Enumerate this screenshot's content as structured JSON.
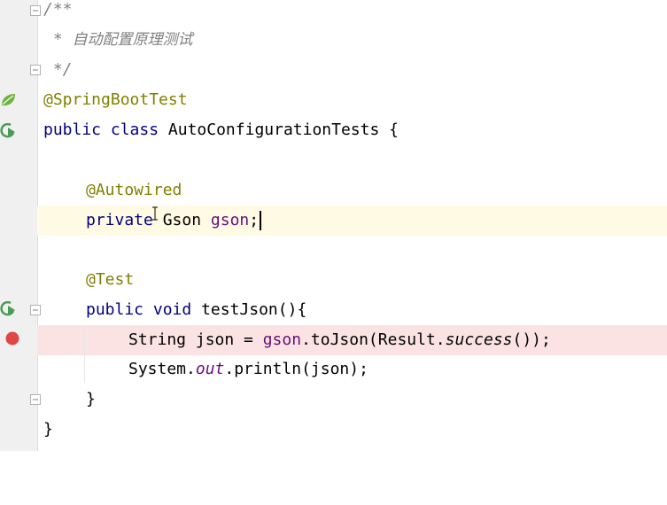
{
  "editor": {
    "lines": {
      "l1": "/**",
      "l2_star": " * ",
      "l2_text": "自动配置原理测试",
      "l3": " */",
      "l4": "@SpringBootTest",
      "l5_public": "public",
      "l5_class": "class",
      "l5_name": "AutoConfigurationTests {",
      "l7": "@Autowired",
      "l8_private": "private",
      "l8_type": " Gson ",
      "l8_field": "gson",
      "l8_semi": ";",
      "l10": "@Test",
      "l11_public": "public",
      "l11_void": "void",
      "l11_rest": "testJson(){",
      "l12_type": "String json = ",
      "l12_field": "gson",
      "l12_call": ".toJson(Result.",
      "l12_method": "success",
      "l12_end": "());",
      "l13_sys": "System.",
      "l13_out": "out",
      "l13_rest": ".println(json);",
      "l14": "}",
      "l15": "}"
    }
  },
  "gutter": {
    "icons": [
      "spring-bean-icon",
      "run-test-icon",
      "run-test-icon",
      "breakpoint-icon"
    ],
    "colors": {
      "spring": "#6db33f",
      "run": "#499c54",
      "breakpoint": "#e04646"
    }
  }
}
